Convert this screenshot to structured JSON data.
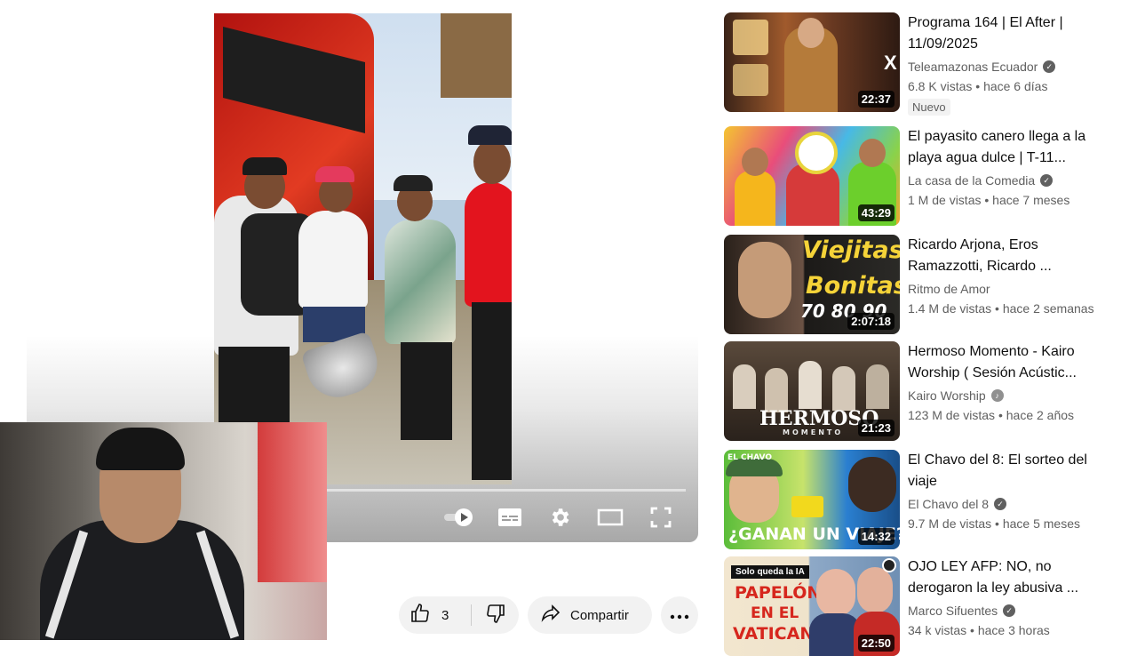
{
  "player": {
    "controls": {
      "autoplay_toggle": "autoplay-toggle-icon",
      "subtitles": "subtitles-icon",
      "settings": "gear-icon",
      "theater": "theater-mode-icon",
      "fullscreen": "fullscreen-icon"
    }
  },
  "actions": {
    "like_count": "3",
    "share_label": "Compartir"
  },
  "sidebar": {
    "items": [
      {
        "title": "Programa 164 | El After | 11/09/2025",
        "channel": "Teleamazonas Ecuador",
        "verified": true,
        "views": "6.8 K vistas",
        "age": "hace 6 días",
        "duration": "22:37",
        "badge": "Nuevo"
      },
      {
        "title": "El payasito canero llega a la playa agua dulce | T-11...",
        "channel": "La casa de la Comedia",
        "verified": true,
        "views": "1 M de vistas",
        "age": "hace 7 meses",
        "duration": "43:29"
      },
      {
        "title": "Ricardo Arjona, Eros Ramazzotti, Ricardo ...",
        "channel": "Ritmo de Amor",
        "verified": false,
        "views": "1.4 M de vistas",
        "age": "hace 2 semanas",
        "duration": "2:07:18",
        "thumb_text": [
          "Viejitas",
          "Bonitas",
          "70 80 90"
        ]
      },
      {
        "title": "Hermoso Momento - Kairo Worship ( Sesión Acústic...",
        "channel": "Kairo Worship",
        "verified": true,
        "views": "123 M de vistas",
        "age": "hace 2 años",
        "duration": "21:23",
        "thumb_text": [
          "HERMOSO",
          "MOMENTO"
        ]
      },
      {
        "title": "El Chavo del 8: El sorteo del viaje",
        "channel": "El Chavo del 8",
        "verified": true,
        "views": "9.7 M de vistas",
        "age": "hace 5 meses",
        "duration": "14:32",
        "thumb_text": [
          "¿GANAN UN VIAJE?",
          "EL CHAVO"
        ]
      },
      {
        "title": "OJO LEY AFP: NO, no derogaron la ley abusiva ...",
        "channel": "Marco Sifuentes",
        "verified": true,
        "views": "34 k vistas",
        "age": "hace 3 horas",
        "duration": "22:50",
        "thumb_text": [
          "Solo queda la IA",
          "PAPELÓN",
          "EN EL",
          "VATICANO"
        ]
      }
    ]
  }
}
